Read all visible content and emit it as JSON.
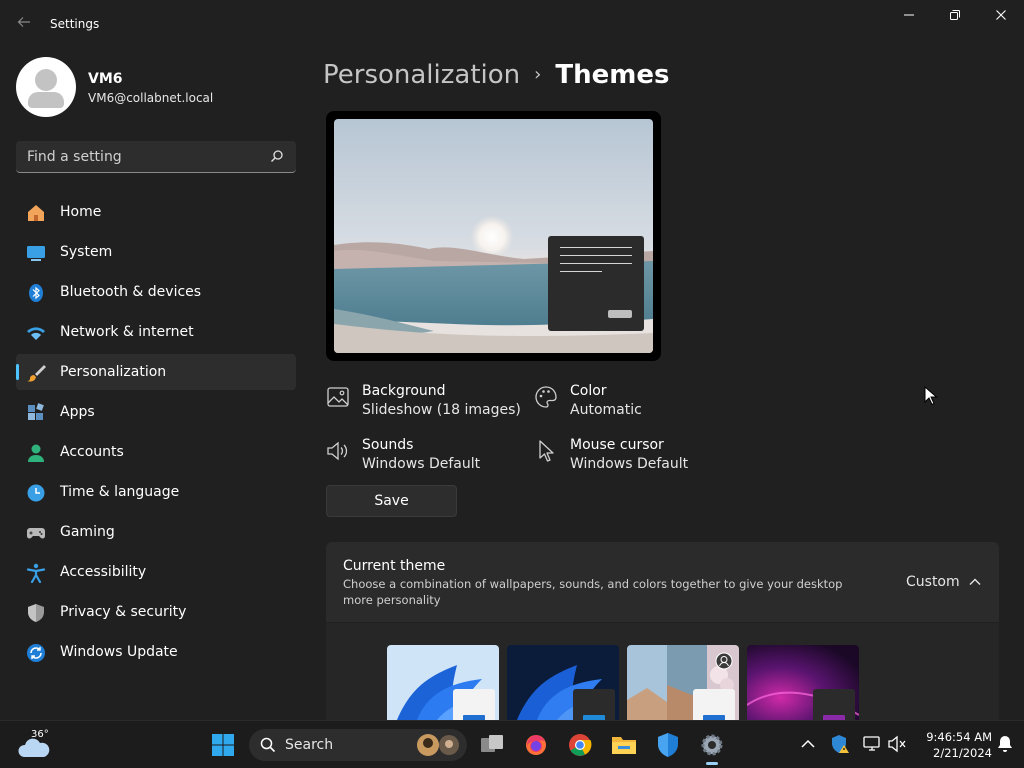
{
  "window": {
    "title": "Settings",
    "controls": {
      "minimize": "—",
      "maximize": "❐",
      "close": "✕"
    }
  },
  "profile": {
    "name": "VM6",
    "email": "VM6@collabnet.local"
  },
  "search": {
    "placeholder": "Find a setting"
  },
  "sidebar": {
    "items": [
      {
        "label": "Home",
        "icon": "home-icon",
        "active": false
      },
      {
        "label": "System",
        "icon": "monitor-icon",
        "active": false
      },
      {
        "label": "Bluetooth & devices",
        "icon": "bluetooth-icon",
        "active": false
      },
      {
        "label": "Network & internet",
        "icon": "wifi-icon",
        "active": false
      },
      {
        "label": "Personalization",
        "icon": "brush-icon",
        "active": true
      },
      {
        "label": "Apps",
        "icon": "apps-icon",
        "active": false
      },
      {
        "label": "Accounts",
        "icon": "person-icon",
        "active": false
      },
      {
        "label": "Time & language",
        "icon": "clock-globe-icon",
        "active": false
      },
      {
        "label": "Gaming",
        "icon": "gamepad-icon",
        "active": false
      },
      {
        "label": "Accessibility",
        "icon": "accessibility-icon",
        "active": false
      },
      {
        "label": "Privacy & security",
        "icon": "shield-icon",
        "active": false
      },
      {
        "label": "Windows Update",
        "icon": "update-icon",
        "active": false
      }
    ]
  },
  "main": {
    "breadcrumb": {
      "parent": "Personalization",
      "separator": "›",
      "current": "Themes"
    },
    "properties": [
      {
        "title": "Background",
        "value": "Slideshow (18 images)",
        "icon": "picture-icon"
      },
      {
        "title": "Color",
        "value": "Automatic",
        "icon": "palette-icon"
      },
      {
        "title": "Sounds",
        "value": "Windows Default",
        "icon": "speaker-icon"
      },
      {
        "title": "Mouse cursor",
        "value": "Windows Default",
        "icon": "cursor-icon"
      }
    ],
    "save_label": "Save",
    "current_theme": {
      "title": "Current theme",
      "description": "Choose a combination of wallpapers, sounds, and colors together to give your desktop more personality",
      "value": "Custom"
    }
  },
  "taskbar": {
    "weather_temp": "36°",
    "search_placeholder": "Search",
    "time": "9:46:54 AM",
    "date": "2/21/2024"
  },
  "colors": {
    "accent": "#4cc2ff",
    "background": "#202020",
    "card": "#2b2b2b",
    "taskbar": "#1c1c1c"
  }
}
